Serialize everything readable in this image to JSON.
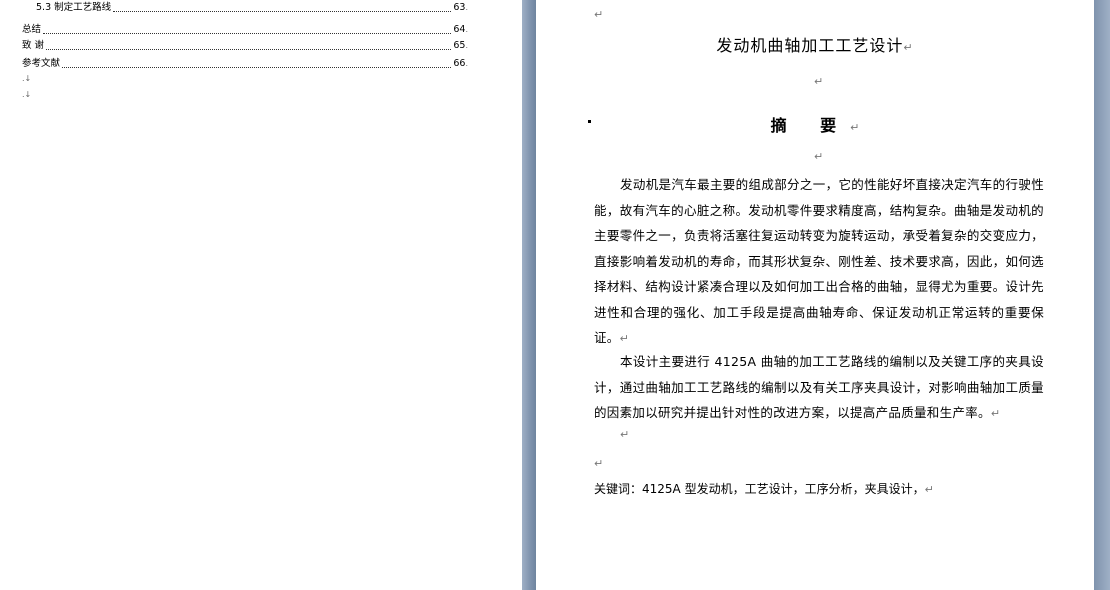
{
  "toc": {
    "items": [
      {
        "label": "5.3  制定工艺路线",
        "page": "63"
      },
      {
        "label": "总结",
        "page": "64"
      },
      {
        "label": "致    谢",
        "page": "65"
      },
      {
        "label": "参考文献",
        "page": "66"
      }
    ]
  },
  "marks": {
    "paragraph": "↵",
    "toc_end": ".",
    "small": ".↓"
  },
  "document": {
    "title": "发动机曲轴加工工艺设计",
    "abstract_heading": "摘  要",
    "paragraph1": "发动机是汽车最主要的组成部分之一，它的性能好坏直接决定汽车的行驶性能，故有汽车的心脏之称。发动机零件要求精度高，结构复杂。曲轴是发动机的主要零件之一，负责将活塞往复运动转变为旋转运动，承受着复杂的交变应力，直接影响着发动机的寿命，而其形状复杂、刚性差、技术要求高，因此，如何选择材料、结构设计紧凑合理以及如何加工出合格的曲轴，显得尤为重要。设计先进性和合理的强化、加工手段是提高曲轴寿命、保证发动机正常运转的重要保证。",
    "paragraph2": "本设计主要进行 4125A 曲轴的加工工艺路线的编制以及关键工序的夹具设计，通过曲轴加工工艺路线的编制以及有关工序夹具设计，对影响曲轴加工质量的因素加以研究并提出针对性的改进方案，以提高产品质量和生产率。",
    "keywords": "关键词：4125A 型发动机，工艺设计，工序分析，夹具设计，"
  }
}
